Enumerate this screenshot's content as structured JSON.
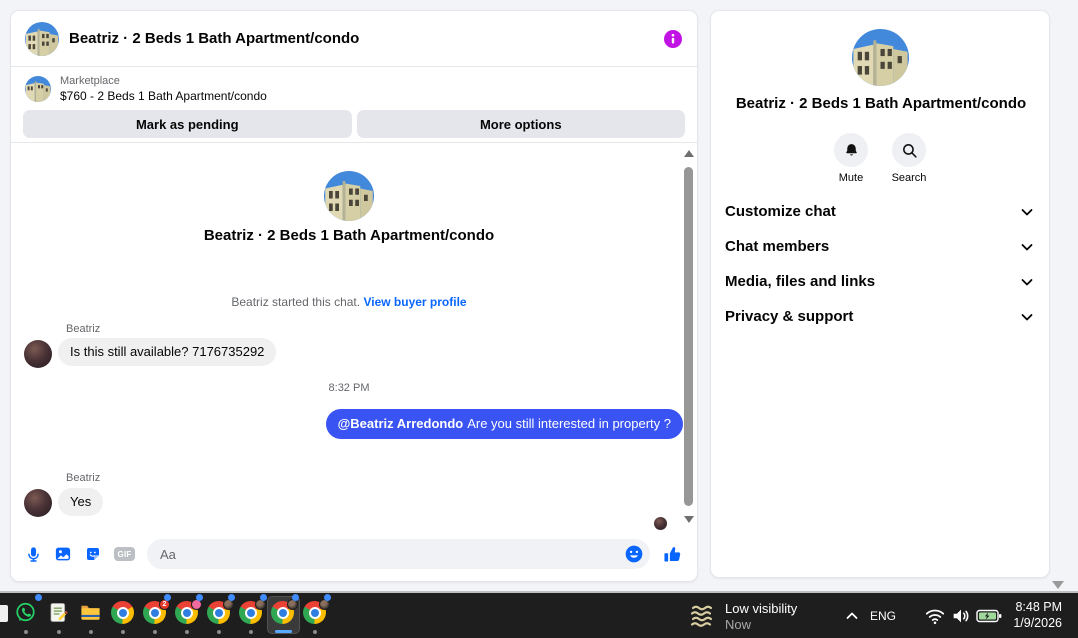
{
  "colors": {
    "accent_blue": "#0866ff",
    "outgoing_bubble": "#3a53f3",
    "info_icon_magenta": "#c113e3",
    "button_gray": "#e4e6eb",
    "taskbar_bg": "#1e1e1e"
  },
  "header": {
    "title": "Beatriz · 2 Beds 1 Bath Apartment/condo"
  },
  "marketplace": {
    "label": "Marketplace",
    "listing": "$760 - 2 Beds 1 Bath Apartment/condo",
    "mark_pending_label": "Mark as pending",
    "more_options_label": "More options"
  },
  "conversation": {
    "intro_title": "Beatriz · 2 Beds 1 Bath Apartment/condo",
    "started_text": "Beatriz started this chat.",
    "buyer_profile_link": "View buyer profile",
    "timestamp": "8:32 PM",
    "messages": [
      {
        "sender": "Beatriz",
        "text": "Is this still available? 7176735292",
        "direction": "in"
      },
      {
        "mention": "@Beatriz Arredondo",
        "text": "Are you still interested in property ?",
        "direction": "out"
      },
      {
        "sender": "Beatriz",
        "text": "Yes",
        "direction": "in"
      }
    ]
  },
  "composer": {
    "placeholder": "Aa",
    "gif_label": "GIF",
    "icons": [
      "microphone-icon",
      "photo-icon",
      "sticker-icon",
      "gif-icon",
      "emoji-icon",
      "thumbs-up-icon"
    ]
  },
  "details": {
    "title": "Beatriz · 2 Beds 1 Bath Apartment/condo",
    "actions": [
      {
        "label": "Mute",
        "icon": "bell-icon"
      },
      {
        "label": "Search",
        "icon": "search-icon"
      }
    ],
    "sections": [
      {
        "label": "Customize chat"
      },
      {
        "label": "Chat members"
      },
      {
        "label": "Media, files and links"
      },
      {
        "label": "Privacy & support"
      }
    ]
  },
  "taskbar": {
    "weather_title": "Low visibility",
    "weather_sub": "Now",
    "language": "ENG",
    "time": "8:48 PM",
    "date": "1/9/2026",
    "chrome_badge_count": "2",
    "apps": [
      "whatsapp",
      "notepad",
      "file-explorer",
      "chrome",
      "chrome",
      "chrome",
      "chrome",
      "chrome",
      "chrome",
      "chrome"
    ],
    "tray_icons": [
      "hidden-icons-chevron",
      "wifi-icon",
      "volume-icon",
      "battery-charging-icon"
    ]
  }
}
